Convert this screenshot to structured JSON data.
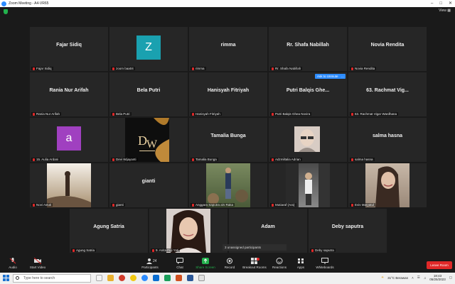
{
  "window": {
    "title": "Zoom Meeting - A4-VR65",
    "view_label": "View"
  },
  "tiles": [
    {
      "id": "t1",
      "big": "Fajar Sidiq",
      "name": "Fajar Sidiq"
    },
    {
      "id": "t2",
      "avatar_letter": "Z",
      "name": "zoom baa04"
    },
    {
      "id": "t3",
      "big": "rimma",
      "name": "rimma"
    },
    {
      "id": "t4",
      "big": "Rr. Shafa Nabillah",
      "name": "Rr. Shafa Nabillah"
    },
    {
      "id": "t5",
      "big": "Novia Rendita",
      "name": "Novia Rendita"
    },
    {
      "id": "t6",
      "big": "Rania Nur Arifah",
      "name": "Rania Nur Arifah"
    },
    {
      "id": "t7",
      "big": "Bela Putri",
      "name": "Bela Putri"
    },
    {
      "id": "t8",
      "big": "Hanisyah Fitriyah",
      "name": "Hanisyah Fitriyah"
    },
    {
      "id": "t9",
      "big": "Putri Balqis Ghe...",
      "name": "Putri Balqis Ghea Novira"
    },
    {
      "id": "t10",
      "big": "63. Rachmat Vig...",
      "name": "63. Rachmat Vigar Wardhana"
    },
    {
      "id": "t11",
      "avatar_letter": "a",
      "name": "15. Aulia Ardani"
    },
    {
      "id": "t12",
      "name": "Devi Wijayanti"
    },
    {
      "id": "t13",
      "big": "Tamalia Bunga",
      "name": "Tamalia Bunga"
    },
    {
      "id": "t14",
      "name": "Adzmiltalia Adrian"
    },
    {
      "id": "t15",
      "big": "salma hasna",
      "name": "salma hasna"
    },
    {
      "id": "t16",
      "name": "Novi Astuti"
    },
    {
      "id": "t17",
      "big": "gianti",
      "name": "gianti"
    },
    {
      "id": "t18",
      "name": "Anggara Saputra a/s Raka"
    },
    {
      "id": "t19",
      "name": "Mutiaraf (Ara)"
    },
    {
      "id": "t20",
      "name": "Evis Maryatul"
    },
    {
      "id": "t21",
      "big": "Agung Satria",
      "name": "Agung Satria"
    },
    {
      "id": "t22",
      "name": "9. Anita Fuji Yati"
    },
    {
      "id": "t23",
      "big": "Adam",
      "name": "Adam"
    },
    {
      "id": "t24",
      "big": "Deby saputra",
      "name": "Deby saputra"
    }
  ],
  "ask_button": "Ask to Unmute",
  "more_button": "...",
  "unassigned": "3 unassigned participants",
  "toolbar": {
    "audio": "Audio",
    "video": "Start Video",
    "participants": "Participants",
    "participants_count": "24",
    "chat": "Chat",
    "share": "Share Screen",
    "record": "Record",
    "breakout": "Breakout Rooms",
    "reactions": "Reactions",
    "apps": "Apps",
    "whiteboards": "Whiteboards",
    "leave": "Leave Room"
  },
  "taskbar": {
    "search_placeholder": "Type here to search",
    "weather": "31°C  Berawan",
    "time": "18:43",
    "date": "05/25/2023"
  },
  "colors": {
    "accent": "#2d8cff",
    "leave": "#e02828",
    "share": "#23b14d",
    "tile_bg": "#262626"
  }
}
